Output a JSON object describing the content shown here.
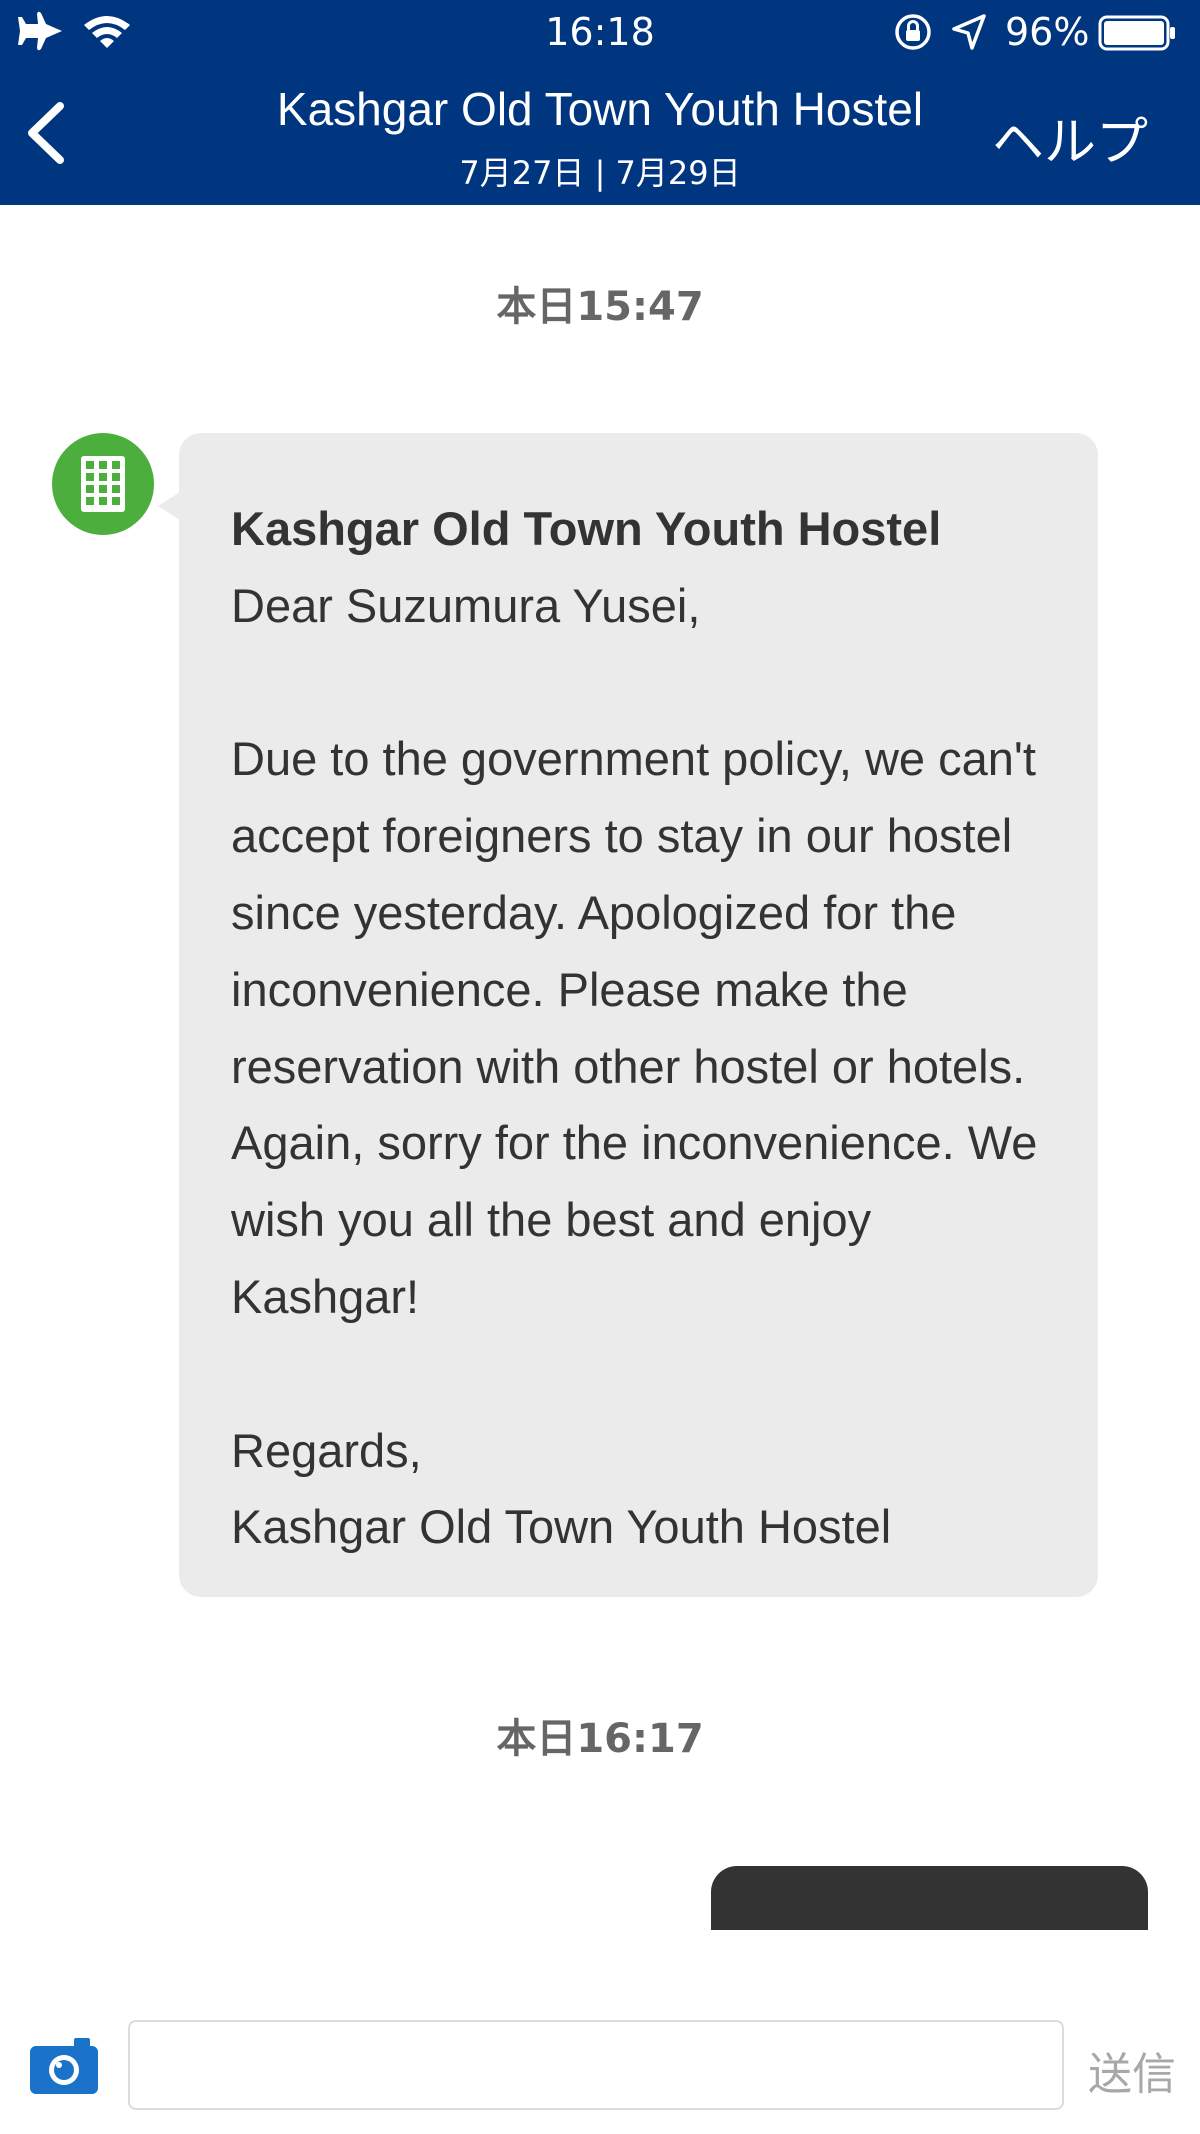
{
  "status_bar": {
    "time": "16:18",
    "battery_percent": "96%",
    "battery_level": 0.96,
    "icons": [
      "airplane-icon",
      "wifi-icon",
      "orientation-lock-icon",
      "location-arrow-icon",
      "battery-icon"
    ]
  },
  "nav": {
    "back_icon": "chevron-left-icon",
    "title": "Kashgar Old Town Youth Hostel",
    "dates": "7月27日 | 7月29日",
    "help_label": "ヘルプ"
  },
  "messages": [
    {
      "timestamp": "本日15:47",
      "avatar_icon": "building-icon",
      "sender": "Kashgar Old Town Youth Hostel",
      "text": "Dear Suzumura Yusei,\n\nDue to the government policy, we can't accept foreigners to stay in our hostel since yesterday. Apologized for the inconvenience. Please make the reservation with other hostel or hotels. Again, sorry for the inconvenience. We wish you all the best and enjoy Kashgar!\n\nRegards,\nKashgar Old Town Youth Hostel"
    },
    {
      "timestamp": "本日16:17"
    }
  ],
  "composer": {
    "camera_icon": "camera-icon",
    "input_value": "",
    "input_placeholder": "",
    "send_label": "送信"
  },
  "colors": {
    "header_bg": "#003580",
    "avatar_bg": "#4caf3d",
    "bubble_bg": "#ebebeb",
    "sent_bubble_bg": "#333333",
    "camera_icon": "#1a73c8",
    "send_disabled": "#a8a8a8"
  }
}
